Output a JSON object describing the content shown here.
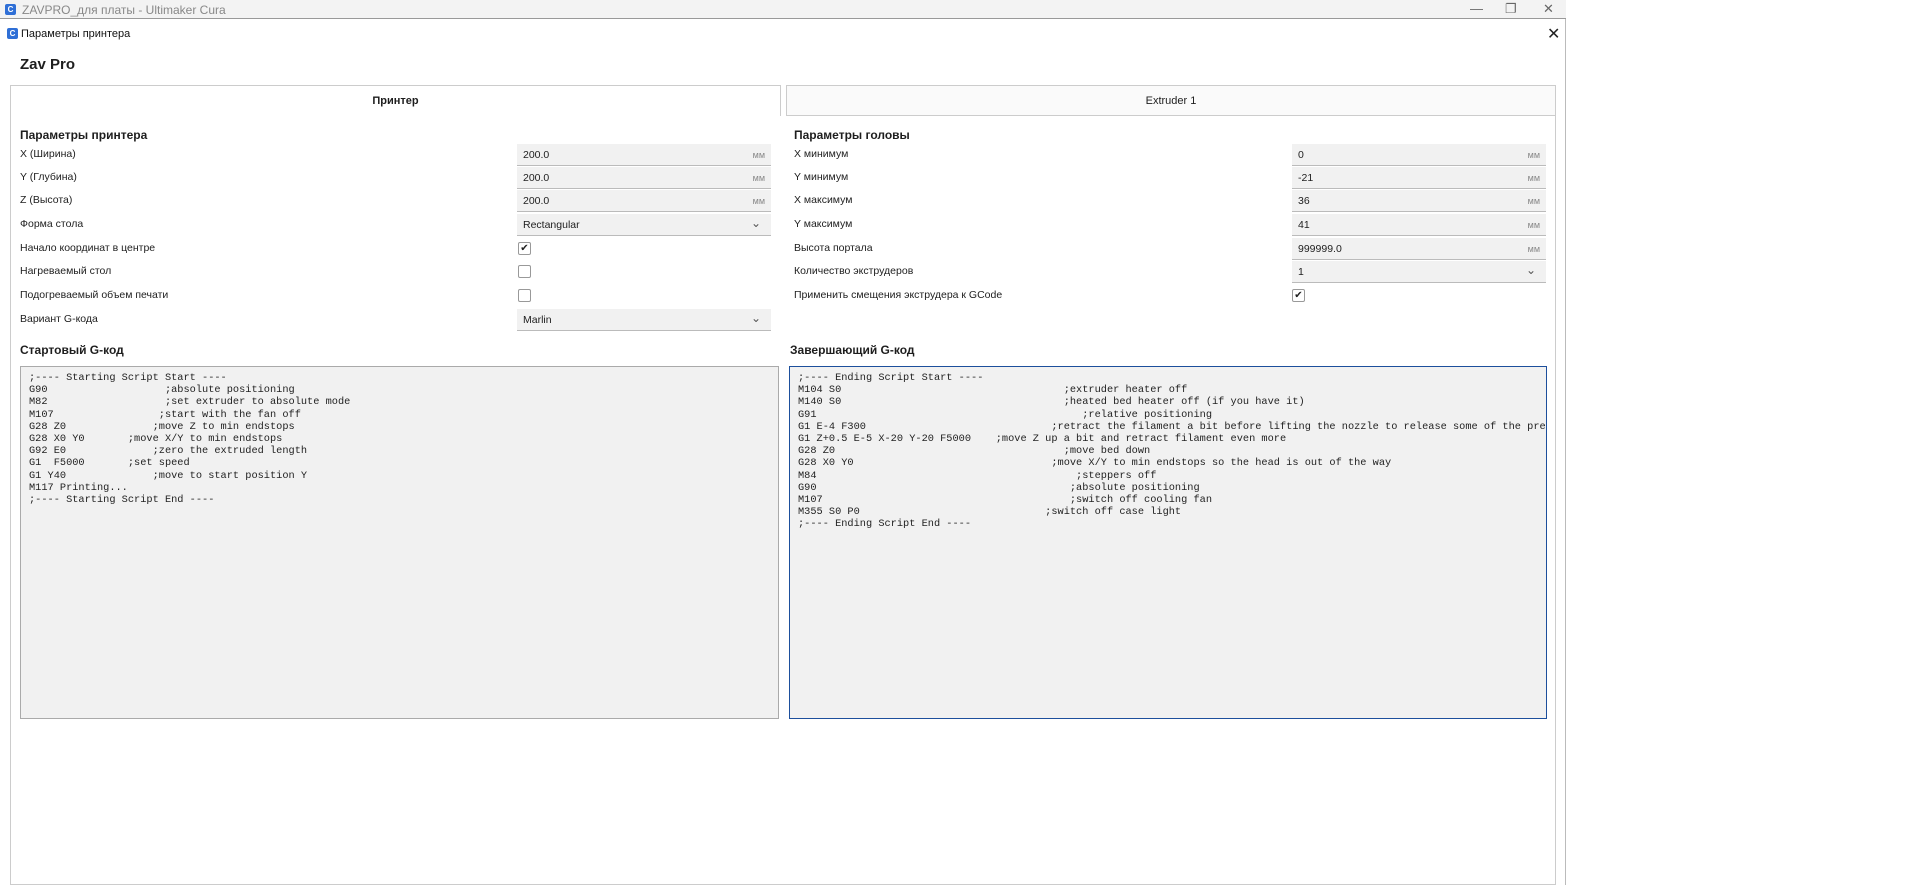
{
  "window": {
    "title": "ZAVPRO_для платы - Ultimaker Cura",
    "app_icon": "C"
  },
  "dialog": {
    "title": "Параметры принтера",
    "machine_name": "Zav Pro"
  },
  "tabs": [
    {
      "label": "Принтер",
      "active": true
    },
    {
      "label": "Extruder 1",
      "active": false
    }
  ],
  "printer": {
    "heading": "Параметры принтера",
    "x_label": "X (Ширина)",
    "x_value": "200.0",
    "x_unit": "мм",
    "y_label": "Y (Глубина)",
    "y_value": "200.0",
    "y_unit": "мм",
    "z_label": "Z (Высота)",
    "z_value": "200.0",
    "z_unit": "мм",
    "shape_label": "Форма стола",
    "shape_value": "Rectangular",
    "origin_label": "Начало координат в центре",
    "origin_checked": true,
    "heated_bed_label": "Нагреваемый стол",
    "heated_bed_checked": false,
    "heated_volume_label": "Подогреваемый объем печати",
    "heated_volume_checked": false,
    "flavor_label": "Вариант G-кода",
    "flavor_value": "Marlin"
  },
  "head": {
    "heading": "Параметры головы",
    "xmin_label": "X минимум",
    "xmin_value": "0",
    "xmin_unit": "мм",
    "ymin_label": "Y минимум",
    "ymin_value": "-21",
    "ymin_unit": "мм",
    "xmax_label": "X максимум",
    "xmax_value": "36",
    "xmax_unit": "мм",
    "ymax_label": "Y максимум",
    "ymax_value": "41",
    "ymax_unit": "мм",
    "gantry_label": "Высота портала",
    "gantry_value": "999999.0",
    "gantry_unit": "мм",
    "extruders_label": "Количество экструдеров",
    "extruders_value": "1",
    "offsets_label": "Применить смещения экструдера к GCode",
    "offsets_checked": true
  },
  "start_gcode": {
    "heading": "Стартовый G-код",
    "text": ";---- Starting Script Start ----\nG90                   ;absolute positioning\nM82                   ;set extruder to absolute mode\nM107                 ;start with the fan off\nG28 Z0              ;move Z to min endstops\nG28 X0 Y0       ;move X/Y to min endstops\nG92 E0              ;zero the extruded length\nG1  F5000       ;set speed\nG1 Y40              ;move to start position Y\nM117 Printing...\n;---- Starting Script End ----"
  },
  "end_gcode": {
    "heading": "Завершающий G-код",
    "text": ";---- Ending Script Start ----\nM104 S0                                    ;extruder heater off\nM140 S0                                    ;heated bed heater off (if you have it)\nG91                                           ;relative positioning\nG1 E-4 F300                              ;retract the filament a bit before lifting the nozzle to release some of the pressure\nG1 Z+0.5 E-5 X-20 Y-20 F5000    ;move Z up a bit and retract filament even more\nG28 Z0                                     ;move bed down\nG28 X0 Y0                                ;move X/Y to min endstops so the head is out of the way\nM84                                          ;steppers off\nG90                                         ;absolute positioning\nM107                                        ;switch off cooling fan\nM355 S0 P0                              ;switch off case light\n;---- Ending Script End ----"
  }
}
